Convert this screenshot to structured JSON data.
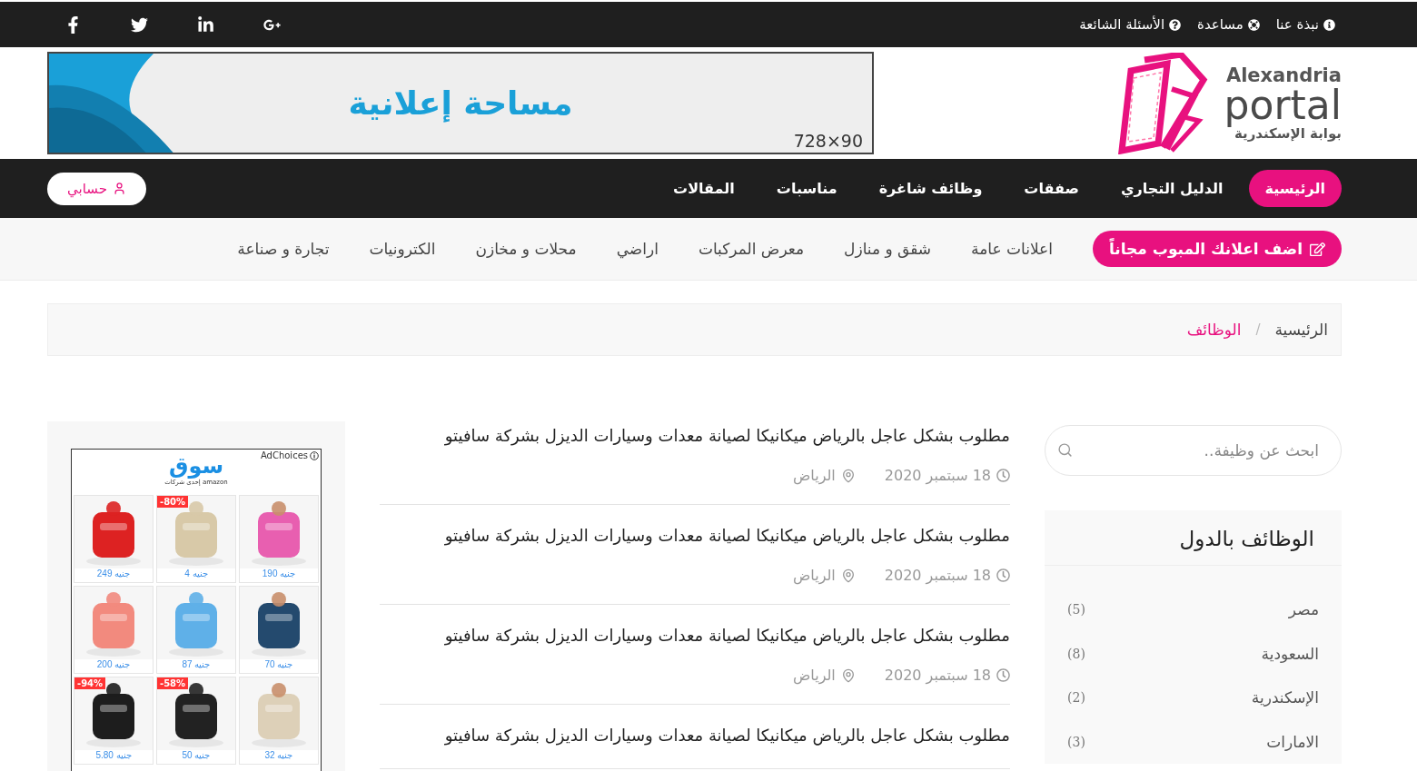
{
  "top_bar": {
    "links": [
      {
        "label": "نبذة عنا"
      },
      {
        "label": "مساعدة"
      },
      {
        "label": "الأسئلة الشائعة"
      }
    ]
  },
  "logo": {
    "line_1": "Alexandria",
    "line_2": "portal",
    "line_3": "بوابة الإسكندرية"
  },
  "banner": {
    "text": "مساحة إعلانية",
    "size": "728×90"
  },
  "main_nav": {
    "items": [
      {
        "label": "الرئيسية",
        "selected": true
      },
      {
        "label": "الدليل التجاري",
        "selected": false
      },
      {
        "label": "صفقات",
        "selected": false
      },
      {
        "label": "وظائف شاغرة",
        "selected": false
      },
      {
        "label": "مناسبات",
        "selected": false
      },
      {
        "label": "المقالات",
        "selected": false
      }
    ],
    "account": "حسابي"
  },
  "category_nav": {
    "post_button": "اضف اعلانك المبوب مجاناً",
    "items": [
      "اعلانات عامة",
      "شقق و منازل",
      "معرض المركبات",
      "اراضي",
      "محلات و مخازن",
      "الكترونيات",
      "تجارة و صناعة"
    ]
  },
  "breadcrumb_separator": "/",
  "breadcrumb": [
    {
      "label": "الرئيسية",
      "selected": false
    },
    {
      "label": "الوظائف",
      "selected": true
    }
  ],
  "search": {
    "placeholder": "ابحث عن وظيفة.."
  },
  "countries": {
    "title": "الوظائف بالدول",
    "items": [
      {
        "name": "مصر",
        "count": "(5)"
      },
      {
        "name": "السعودية",
        "count": "(8)"
      },
      {
        "name": "الإسكندرية",
        "count": "(2)"
      },
      {
        "name": "الامارات",
        "count": "(3)"
      }
    ]
  },
  "jobs": [
    {
      "title": "مطلوب بشكل عاجل بالرياض ميكانيكا لصيانة معدات وسيارات الديزل بشركة سافيتو",
      "date": "18 سبتمبر 2020",
      "location": "الرياض"
    },
    {
      "title": "مطلوب بشكل عاجل بالرياض ميكانيكا لصيانة معدات وسيارات الديزل بشركة سافيتو",
      "date": "18 سبتمبر 2020",
      "location": "الرياض"
    },
    {
      "title": "مطلوب بشكل عاجل بالرياض ميكانيكا لصيانة معدات وسيارات الديزل بشركة سافيتو",
      "date": "18 سبتمبر 2020",
      "location": "الرياض"
    },
    {
      "title": "مطلوب بشكل عاجل بالرياض ميكانيكا لصيانة معدات وسيارات الديزل بشركة سافيتو"
    }
  ],
  "ad": {
    "choices": "AdChoices",
    "brand": "سوق",
    "tagline": "إحدى شركات amazon",
    "products": [
      {
        "price": "جنيه 190"
      },
      {
        "price": "جنيه 4",
        "discount": "-80%"
      },
      {
        "price": "جنيه 249"
      },
      {
        "price": "جنيه 70"
      },
      {
        "price": "جنيه 87"
      },
      {
        "price": "جنيه 200"
      },
      {
        "price": "جنيه 32"
      },
      {
        "price": "جنيه 50",
        "discount": "-58%"
      },
      {
        "price": "جنيه 5.80",
        "discount": "-94%"
      }
    ]
  }
}
